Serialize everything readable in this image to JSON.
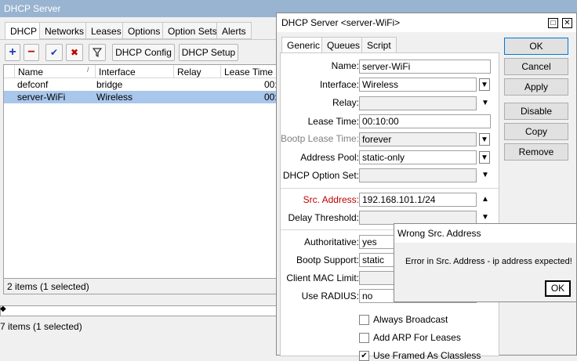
{
  "left": {
    "title": "DHCP Server",
    "tabs": [
      "DHCP",
      "Networks",
      "Leases",
      "Options",
      "Option Sets",
      "Alerts"
    ],
    "toolbar": {
      "add": "+",
      "remove": "−",
      "enable": "✔",
      "disable": "✖",
      "filter": "▼",
      "dhcp_config": "DHCP Config",
      "dhcp_setup": "DHCP Setup"
    },
    "columns": [
      "Name",
      "Interface",
      "Relay",
      "Lease Time"
    ],
    "sort_indicator": "/",
    "rows": [
      {
        "name": "defconf",
        "interface": "bridge",
        "relay": "",
        "lease": "00:"
      },
      {
        "name": "server-WiFi",
        "interface": "Wireless",
        "relay": "",
        "lease": "00:"
      }
    ],
    "status": "2 items (1 selected)",
    "status_bottom": "7 items (1 selected)"
  },
  "server": {
    "title": "DHCP Server <server-WiFi>",
    "tabs": [
      "Generic",
      "Queues",
      "Script"
    ],
    "fields": {
      "name_label": "Name:",
      "name_value": "server-WiFi",
      "interface_label": "Interface:",
      "interface_value": "Wireless",
      "relay_label": "Relay:",
      "relay_value": "",
      "lease_label": "Lease Time:",
      "lease_value": "00:10:00",
      "bootp_lease_label": "Bootp Lease Time:",
      "bootp_lease_value": "forever",
      "pool_label": "Address Pool:",
      "pool_value": "static-only",
      "option_set_label": "DHCP Option Set:",
      "option_set_value": "",
      "src_label": "Src. Address:",
      "src_value": "192.168.101.1/24",
      "delay_label": "Delay Threshold:",
      "delay_value": "",
      "auth_label": "Authoritative:",
      "auth_value": "yes",
      "bootp_support_label": "Bootp Support:",
      "bootp_support_value": "static",
      "mac_limit_label": "Client MAC Limit:",
      "mac_limit_value": "",
      "radius_label": "Use RADIUS:",
      "radius_value": "no"
    },
    "checkboxes": {
      "broadcast": "Always Broadcast",
      "arp": "Add ARP For Leases",
      "classless": "Use Framed As Classless"
    },
    "buttons": {
      "ok": "OK",
      "cancel": "Cancel",
      "apply": "Apply",
      "disable": "Disable",
      "copy": "Copy",
      "remove": "Remove"
    }
  },
  "error": {
    "title": "Wrong Src. Address",
    "message": "Error in Src. Address - ip address expected!",
    "ok": "OK"
  }
}
